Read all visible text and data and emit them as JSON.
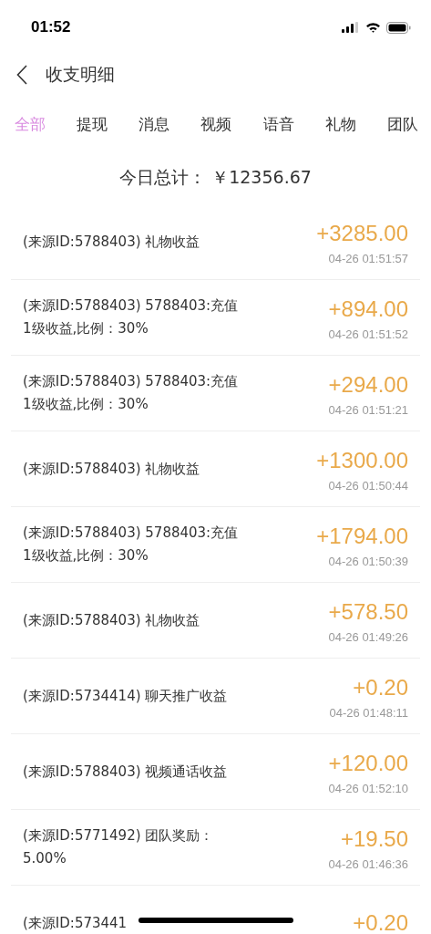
{
  "status_bar": {
    "time": "01:52"
  },
  "header": {
    "title": "收支明细"
  },
  "tabs": [
    {
      "label": "全部",
      "selected": true
    },
    {
      "label": "提现",
      "selected": false
    },
    {
      "label": "消息",
      "selected": false
    },
    {
      "label": "视频",
      "selected": false
    },
    {
      "label": "语音",
      "selected": false
    },
    {
      "label": "礼物",
      "selected": false
    },
    {
      "label": "团队",
      "selected": false
    }
  ],
  "summary": {
    "label": "今日总计：",
    "amount": "￥12356.67"
  },
  "records": [
    {
      "description": "(来源ID:5788403) 礼物收益",
      "amount": "+3285.00",
      "time": "04-26 01:51:57"
    },
    {
      "description": "(来源ID:5788403) 5788403:充值1级收益,比例：30%",
      "amount": "+894.00",
      "time": "04-26 01:51:52"
    },
    {
      "description": "(来源ID:5788403) 5788403:充值1级收益,比例：30%",
      "amount": "+294.00",
      "time": "04-26 01:51:21"
    },
    {
      "description": "(来源ID:5788403) 礼物收益",
      "amount": "+1300.00",
      "time": "04-26 01:50:44"
    },
    {
      "description": "(来源ID:5788403) 5788403:充值1级收益,比例：30%",
      "amount": "+1794.00",
      "time": "04-26 01:50:39"
    },
    {
      "description": "(来源ID:5788403) 礼物收益",
      "amount": "+578.50",
      "time": "04-26 01:49:26"
    },
    {
      "description": "(来源ID:5734414) 聊天推广收益",
      "amount": "+0.20",
      "time": "04-26 01:48:11"
    },
    {
      "description": "(来源ID:5788403) 视频通话收益",
      "amount": "+120.00",
      "time": "04-26 01:52:10"
    },
    {
      "description": "(来源ID:5771492) 团队奖励：5.00%",
      "amount": "+19.50",
      "time": "04-26 01:46:36"
    },
    {
      "description": "(来源ID:573441",
      "amount": "+0.20"
    }
  ]
}
